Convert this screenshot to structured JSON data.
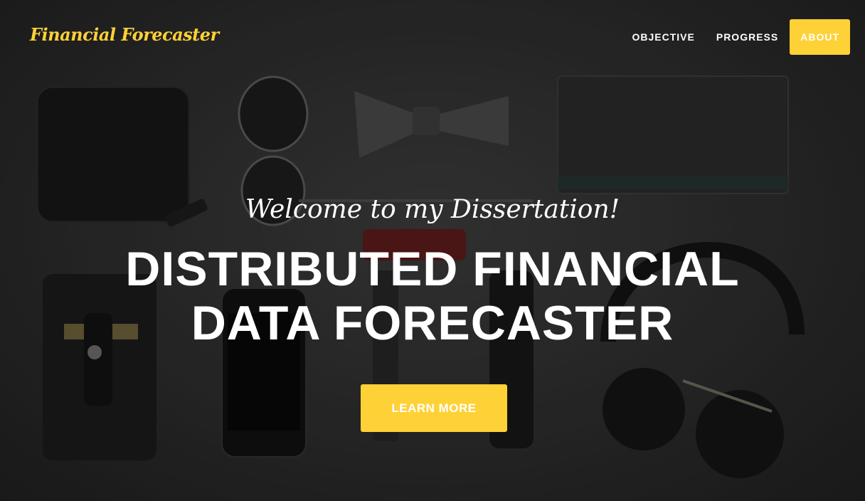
{
  "colors": {
    "accent": "#fed136",
    "text_light": "#ffffff",
    "background": "#2f2f2f"
  },
  "navbar": {
    "brand": "Financial Forecaster",
    "links": [
      {
        "label": "OBJECTIVE",
        "active": false
      },
      {
        "label": "PROGRESS",
        "active": false
      },
      {
        "label": "ABOUT",
        "active": true
      }
    ]
  },
  "hero": {
    "subtitle": "Welcome to my Dissertation!",
    "title_line1": "DISTRIBUTED FINANCIAL",
    "title_line2": "DATA FORECASTER",
    "button_label": "LEARN MORE"
  }
}
